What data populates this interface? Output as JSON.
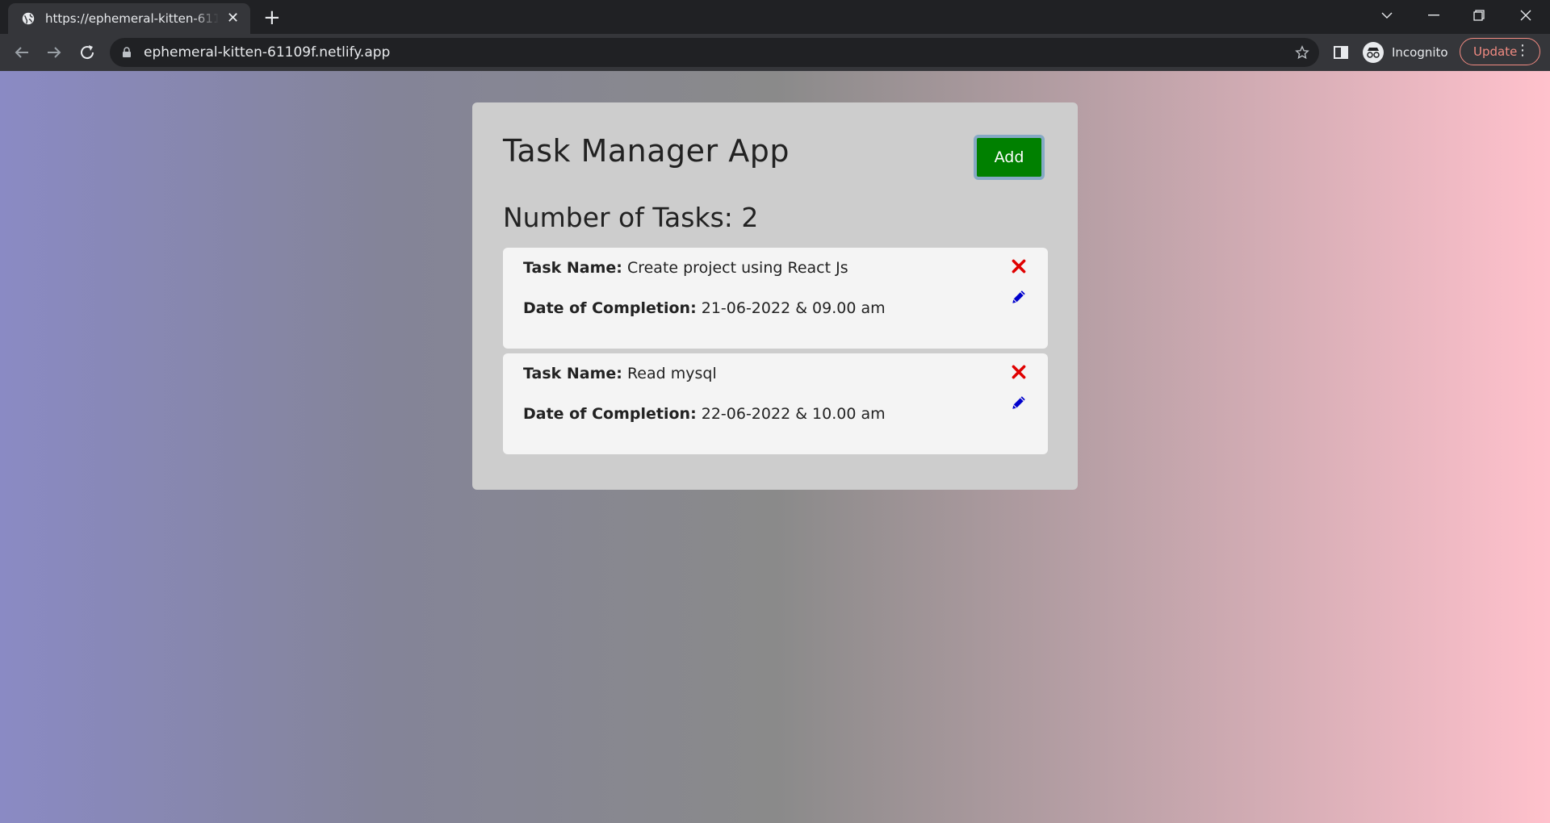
{
  "browser": {
    "tab_title": "https://ephemeral-kitten-61109f.netlify.app",
    "url": "ephemeral-kitten-61109f.netlify.app",
    "profile_label": "Incognito",
    "update_label": "Update",
    "icons": [
      "globe-icon",
      "close-icon",
      "plus-icon",
      "back-icon",
      "forward-icon",
      "reload-icon",
      "lock-icon",
      "star-icon",
      "side-panel-icon",
      "incognito-icon",
      "kebab-menu-icon"
    ]
  },
  "app": {
    "title": "Task Manager App",
    "add_label": "Add",
    "count_label": "Number of Tasks: 2",
    "task_name_label": "Task Name:",
    "date_label": "Date of Completion:",
    "tasks": [
      {
        "name": "Create project using React Js",
        "date": "21-06-2022 & 09.00 am"
      },
      {
        "name": "Read mysql",
        "date": "22-06-2022 & 10.00 am"
      }
    ],
    "colors": {
      "add_button": "#008000",
      "delete_icon": "#e00000",
      "edit_icon": "#0000cc"
    }
  }
}
